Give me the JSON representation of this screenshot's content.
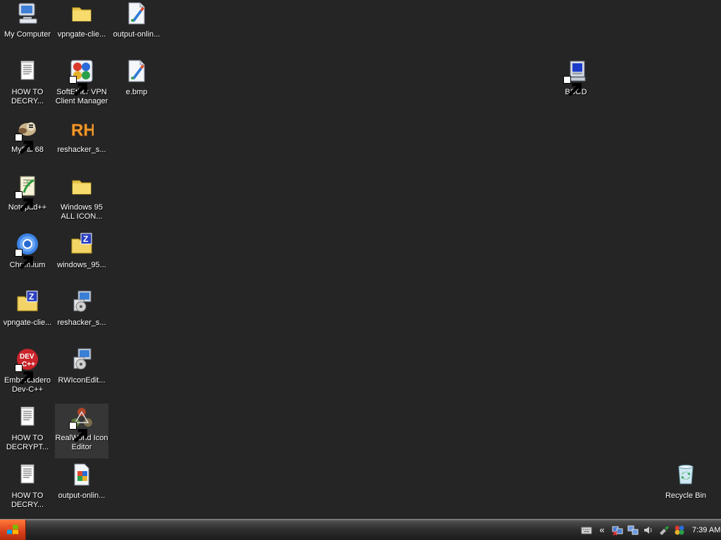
{
  "desktop": {
    "icons": [
      {
        "label": "My Computer"
      },
      {
        "label": "vpngate-clie..."
      },
      {
        "label": "output-onlin..."
      },
      {
        "label": "HOW TO\nDECRY..."
      },
      {
        "label": "SoftEther VPN\nClient Manager"
      },
      {
        "label": "e.bmp"
      },
      {
        "label": "BSOD"
      },
      {
        "label": "MyPal 68"
      },
      {
        "label": "reshacker_s..."
      },
      {
        "label": "Notepad++"
      },
      {
        "label": "Windows 95\nALL ICON..."
      },
      {
        "label": "Chromium"
      },
      {
        "label": "windows_95..."
      },
      {
        "label": "vpngate-clie..."
      },
      {
        "label": "reshacker_s..."
      },
      {
        "label": "Embarcadero\nDev-C++"
      },
      {
        "label": "RWIconEdit..."
      },
      {
        "label": "HOW TO\nDECRYPT..."
      },
      {
        "label": "RealWorld Icon\nEditor"
      },
      {
        "label": "HOW TO\nDECRY..."
      },
      {
        "label": "output-onlin..."
      },
      {
        "label": "Recycle Bin"
      }
    ]
  },
  "taskbar": {
    "tray_expand": "«",
    "clock": "7:39 AM"
  }
}
